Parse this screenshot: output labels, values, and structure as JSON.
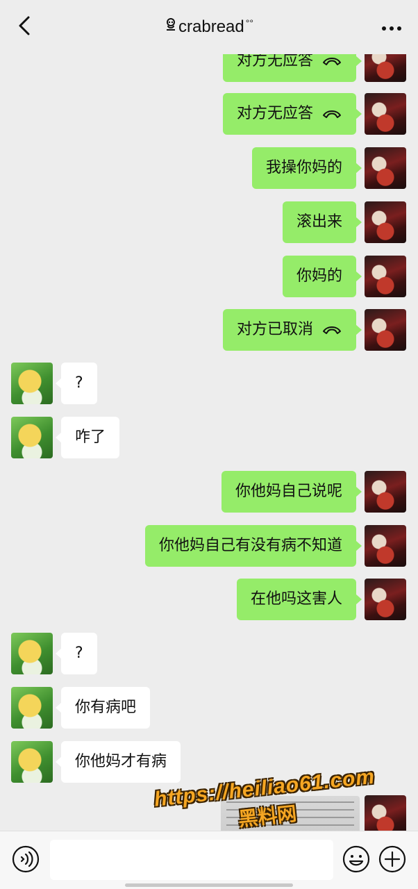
{
  "header": {
    "title": "crabread",
    "title_prefix_icon": "pig-nose-icon",
    "title_suffix": "°°",
    "back_icon": "chevron-left-icon",
    "more_icon": "more-dots-icon"
  },
  "messages": [
    {
      "side": "out",
      "text": "对方无应答",
      "call_icon": true
    },
    {
      "side": "out",
      "text": "对方无应答",
      "call_icon": true
    },
    {
      "side": "out",
      "text": "我操你妈的",
      "call_icon": false
    },
    {
      "side": "out",
      "text": "滚出来",
      "call_icon": false
    },
    {
      "side": "out",
      "text": "你妈的",
      "call_icon": false
    },
    {
      "side": "out",
      "text": "对方已取消",
      "call_icon": true
    },
    {
      "side": "in",
      "text": "?",
      "call_icon": false
    },
    {
      "side": "in",
      "text": "咋了",
      "call_icon": false
    },
    {
      "side": "out",
      "text": "你他妈自己说呢",
      "call_icon": false
    },
    {
      "side": "out",
      "text": "你他妈自己有没有病不知道",
      "call_icon": false
    },
    {
      "side": "out",
      "text": "在他吗这害人",
      "call_icon": false
    },
    {
      "side": "in",
      "text": "?",
      "call_icon": false
    },
    {
      "side": "in",
      "text": "你有病吧",
      "call_icon": false
    },
    {
      "side": "in",
      "text": "你他妈才有病",
      "call_icon": false
    }
  ],
  "image_message": {
    "side": "out"
  },
  "watermark": {
    "url": "https://heiliao61.com",
    "site_name": "黑料网"
  },
  "input_bar": {
    "voice_icon": "voice-icon",
    "emoji_icon": "emoji-icon",
    "plus_icon": "plus-circle-icon",
    "value": ""
  },
  "colors": {
    "outgoing_bubble": "#95ec69",
    "incoming_bubble": "#ffffff",
    "background": "#ededed",
    "watermark": "#f5a623"
  }
}
